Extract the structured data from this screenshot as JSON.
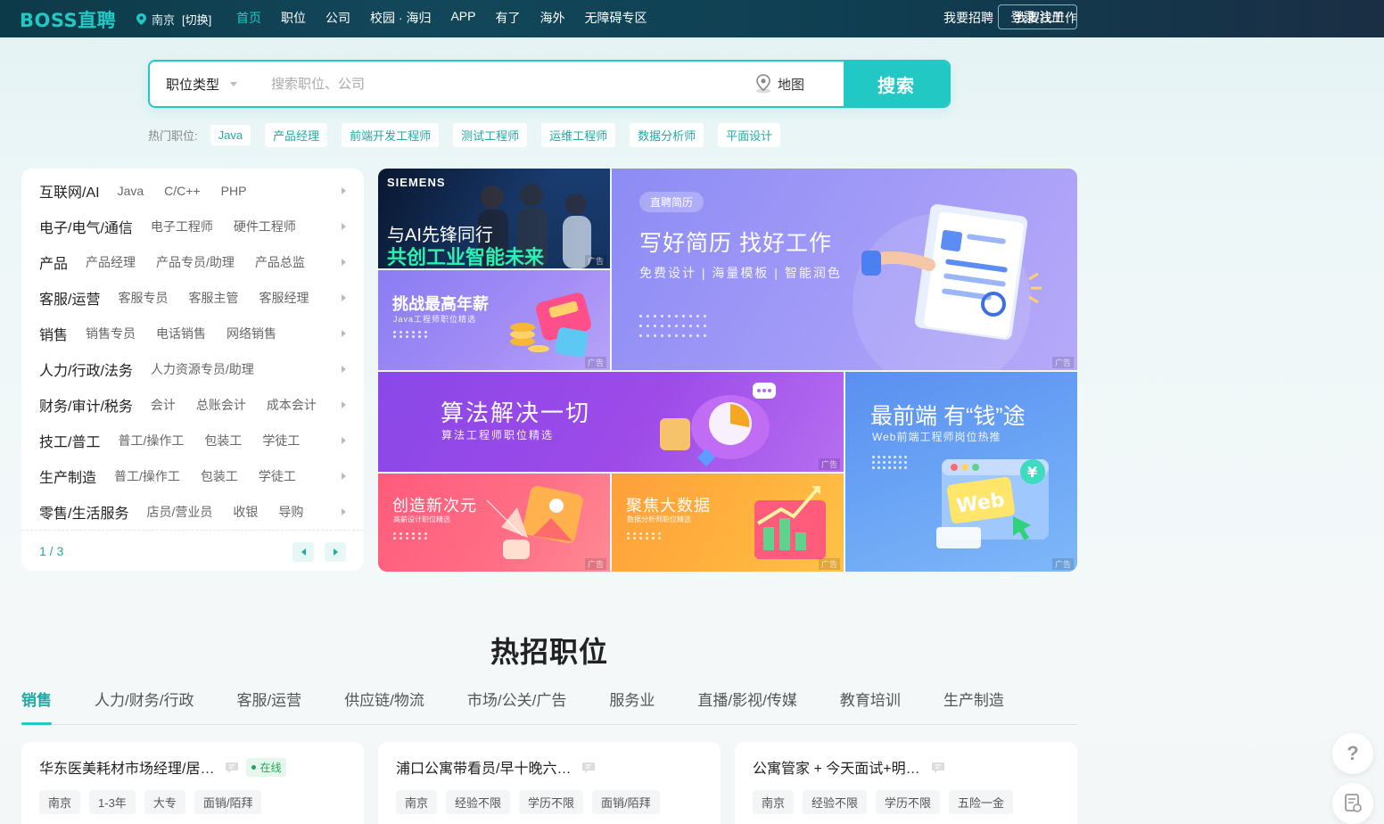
{
  "header": {
    "logo": "BOSS直聘",
    "city": "南京",
    "city_switch": "[切换]",
    "nav": [
      "首页",
      "职位",
      "公司",
      "校园 · 海归",
      "APP",
      "有了",
      "海外",
      "无障碍专区"
    ],
    "right_nav": [
      "我要招聘",
      "我要找工作"
    ],
    "login": "登录/注册"
  },
  "search": {
    "job_type": "职位类型",
    "placeholder": "搜索职位、公司",
    "map": "地图",
    "button": "搜索",
    "hot_label": "热门职位:",
    "hot_tags": [
      "Java",
      "产品经理",
      "前端开发工程师",
      "测试工程师",
      "运维工程师",
      "数据分析师",
      "平面设计"
    ]
  },
  "categories": [
    {
      "main": "互联网/AI",
      "subs": [
        "Java",
        "C/C++",
        "PHP"
      ]
    },
    {
      "main": "电子/电气/通信",
      "subs": [
        "电子工程师",
        "硬件工程师"
      ]
    },
    {
      "main": "产品",
      "subs": [
        "产品经理",
        "产品专员/助理",
        "产品总监"
      ]
    },
    {
      "main": "客服/运营",
      "subs": [
        "客服专员",
        "客服主管",
        "客服经理"
      ]
    },
    {
      "main": "销售",
      "subs": [
        "销售专员",
        "电话销售",
        "网络销售"
      ]
    },
    {
      "main": "人力/行政/法务",
      "subs": [
        "人力资源专员/助理"
      ]
    },
    {
      "main": "财务/审计/税务",
      "subs": [
        "会计",
        "总账会计",
        "成本会计"
      ]
    },
    {
      "main": "技工/普工",
      "subs": [
        "普工/操作工",
        "包装工",
        "学徒工"
      ]
    },
    {
      "main": "生产制造",
      "subs": [
        "普工/操作工",
        "包装工",
        "学徒工"
      ]
    },
    {
      "main": "零售/生活服务",
      "subs": [
        "店员/营业员",
        "收银",
        "导购"
      ]
    }
  ],
  "pager": "1 / 3",
  "banners": {
    "ad_label": "广告",
    "siemens": {
      "brand": "SIEMENS",
      "line1": "与AI先锋同行",
      "line2": "共创工业智能未来"
    },
    "salary": {
      "title": "挑战最高年薪",
      "sub": "Java工程师职位精选"
    },
    "resume": {
      "badge": "直聘简历",
      "title": "写好简历 找好工作",
      "sub": "免费设计 | 海量模板 | 智能润色"
    },
    "algo": {
      "title": "算法解决一切",
      "sub": "算法工程师职位精选"
    },
    "web": {
      "title": "最前端 有“钱”途",
      "sub": "Web前端工程师岗位热推",
      "icon": "Web"
    },
    "design": {
      "title": "创造新次元",
      "sub": "高薪设计职位精选"
    },
    "data": {
      "title": "聚焦大数据",
      "sub": "数据分析师职位精选"
    }
  },
  "hot_jobs": {
    "title": "热招职位",
    "tabs": [
      "销售",
      "人力/财务/行政",
      "客服/运营",
      "供应链/物流",
      "市场/公关/广告",
      "服务业",
      "直播/影视/传媒",
      "教育培训",
      "生产制造"
    ],
    "online_label": "在线",
    "cards": [
      {
        "name": "华东医美耗材市场经理/居…",
        "online": true,
        "tags": [
          "南京",
          "1-3年",
          "大专",
          "面销/陌拜"
        ]
      },
      {
        "name": "浦口公寓带看员/早十晚六…",
        "online": false,
        "tags": [
          "南京",
          "经验不限",
          "学历不限",
          "面销/陌拜"
        ]
      },
      {
        "name": "公寓管家 + 今天面试+明…",
        "online": false,
        "tags": [
          "南京",
          "经验不限",
          "学历不限",
          "五险一金"
        ]
      }
    ]
  },
  "side": {
    "help": "?"
  },
  "colors": {
    "brand": "#22c8c3",
    "brand_dark": "#22a9a5",
    "nav_bg": "#12475a"
  }
}
